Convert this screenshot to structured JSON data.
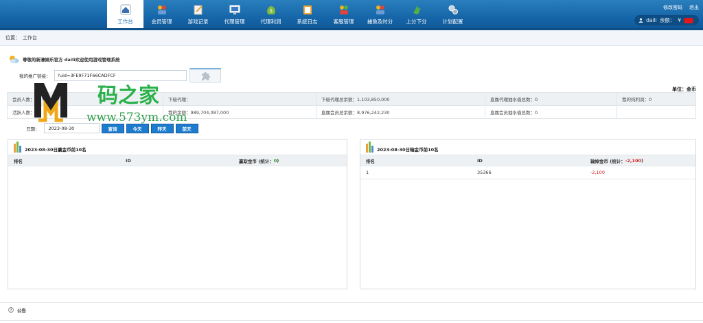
{
  "nav": [
    {
      "label": "工作台",
      "icon": "home-icon",
      "active": true
    },
    {
      "label": "会员管理",
      "icon": "members-icon"
    },
    {
      "label": "游戏记录",
      "icon": "game-record-icon"
    },
    {
      "label": "代理管理",
      "icon": "monitor-icon"
    },
    {
      "label": "代理利润",
      "icon": "money-bag-icon"
    },
    {
      "label": "系统日志",
      "icon": "clipboard-icon"
    },
    {
      "label": "客服管理",
      "icon": "support-icon"
    },
    {
      "label": "捕鱼及时分",
      "icon": "fish-icon"
    },
    {
      "label": "上分下分",
      "icon": "transfer-icon"
    },
    {
      "label": "计划配置",
      "icon": "gears-icon"
    }
  ],
  "top": {
    "change_password": "修改密码",
    "logout": "退出"
  },
  "user": {
    "name": "daili",
    "balance_label": "余额：",
    "currency": "¥"
  },
  "breadcrumb": {
    "label": "位置：",
    "current": "工作台"
  },
  "welcome": "尊敬的新濠娱乐官方 daili欢迎使用游戏管理系统",
  "promo": {
    "label": "我的推广链接：",
    "value": "?uid=3FE9F71F66CADFCF"
  },
  "unit": "单位：金币",
  "stats": {
    "row1": [
      "会员人数：",
      "下级代理：",
      "下级代理总余额：1,103,850,000",
      "直属代理抽水值总数：0",
      "我的纯利润：0"
    ],
    "row2": [
      "活跃人数：",
      "我的余额：989,704,087,000",
      "直属会员总余额：8,976,242,230",
      "直属会员抽水值总数：0",
      ""
    ]
  },
  "date": {
    "label": "日期：",
    "value": "2023-08-30",
    "query": "查询",
    "today": "今天",
    "yesterday": "昨天",
    "before": "前天"
  },
  "win_panel": {
    "title": "2023-08-30日赢金币前10名",
    "col_rank": "排名",
    "col_id": "ID",
    "col_amount": "赢取金币 (统计：",
    "total": "0",
    "close": ")"
  },
  "lose_panel": {
    "title": "2023-08-30日输金币前10名",
    "col_rank": "排名",
    "col_id": "ID",
    "col_amount": "输掉金币 (统计：",
    "total": "-2,100",
    "close": ")",
    "rows": [
      {
        "rank": "1",
        "id": "35366",
        "amount": "-2,100"
      }
    ]
  },
  "notice": "公告",
  "watermark": {
    "title": "码之家",
    "url": "www.573ym.com"
  },
  "colors": {
    "nav_bg": "#1565a8",
    "button": "#1e7ccf",
    "negative": "#d01b1b",
    "positive": "#16a016"
  }
}
